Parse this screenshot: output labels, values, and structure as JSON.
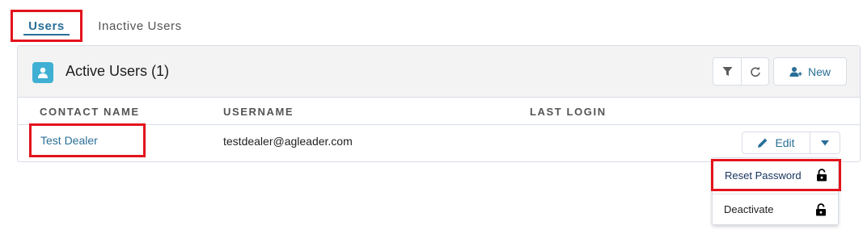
{
  "tabs": [
    {
      "label": "Users",
      "active": true
    },
    {
      "label": "Inactive Users",
      "active": false
    }
  ],
  "card": {
    "title": "Active Users (1)",
    "icon": "user-icon",
    "new_label": "New"
  },
  "table": {
    "columns": [
      "CONTACT NAME",
      "USERNAME",
      "LAST LOGIN"
    ],
    "rows": [
      {
        "contact_name": "Test Dealer",
        "username": "testdealer@agleader.com",
        "last_login": ""
      }
    ],
    "edit_label": "Edit"
  },
  "dropdown": {
    "items": [
      {
        "label": "Reset Password",
        "icon": "lock-icon"
      },
      {
        "label": "Deactivate",
        "icon": "lock-icon"
      }
    ]
  },
  "colors": {
    "accent": "#2a6f97",
    "highlight": "#e3131c",
    "icon_bg": "#3fb0d3"
  }
}
